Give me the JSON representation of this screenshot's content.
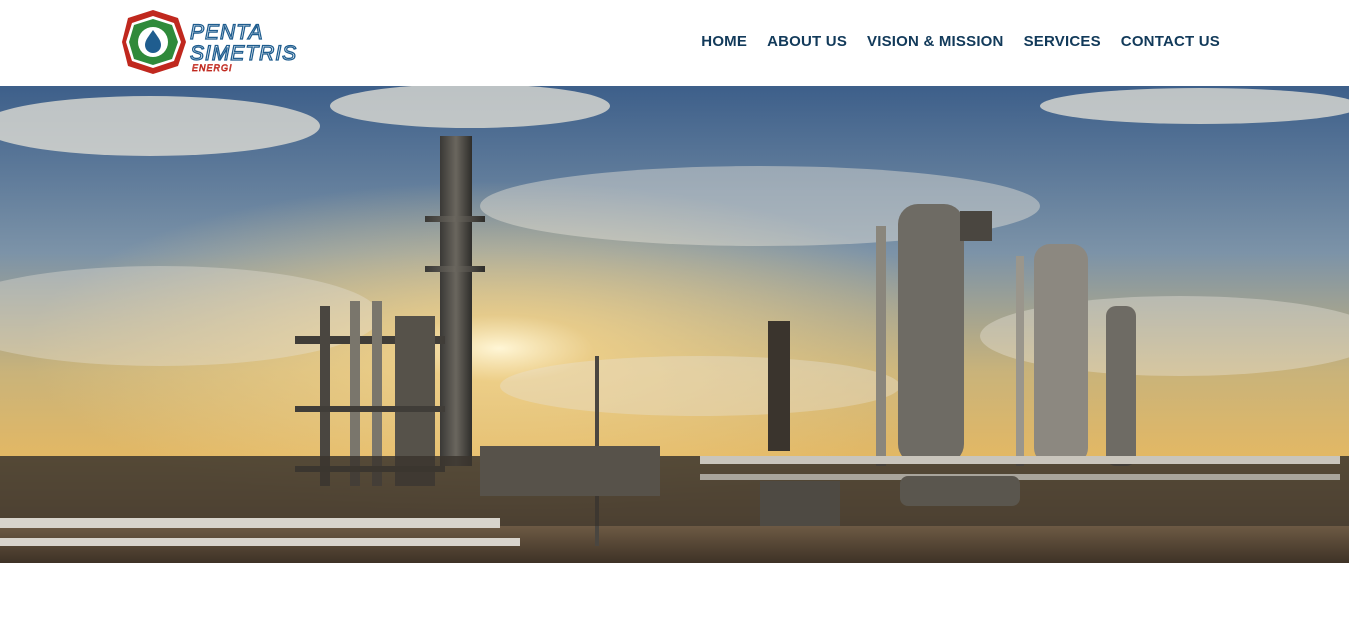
{
  "brand": {
    "name_line1": "PENTA",
    "name_line2": "SIMETRIS",
    "name_line3": "ENERGI",
    "colors": {
      "red": "#c0281e",
      "green": "#2f8a3a",
      "blue": "#1f5d8f",
      "navy": "#123a5a"
    }
  },
  "nav": {
    "items": [
      {
        "label": "HOME"
      },
      {
        "label": "ABOUT US"
      },
      {
        "label": "VISION & MISSION"
      },
      {
        "label": "SERVICES"
      },
      {
        "label": "CONTACT US"
      }
    ]
  },
  "hero": {
    "subject": "gas processing plant at sunset"
  }
}
